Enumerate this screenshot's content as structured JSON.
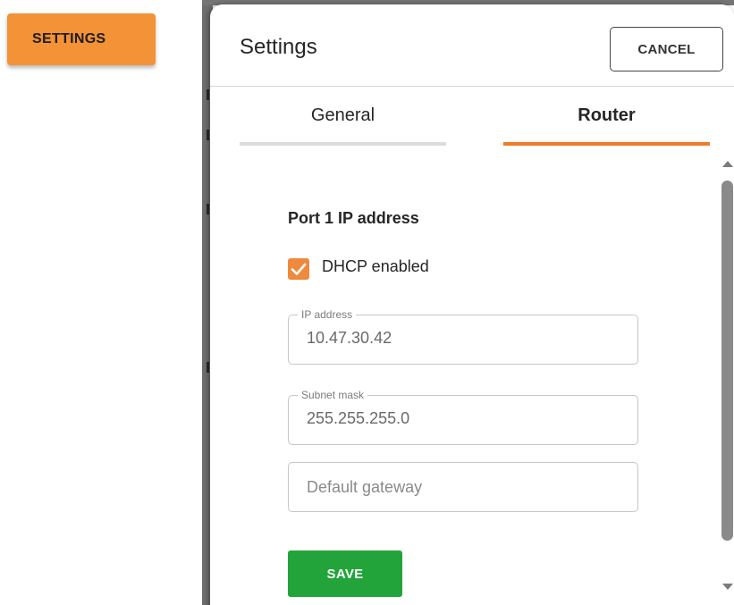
{
  "app": {
    "settings_button_label": "SETTINGS"
  },
  "dialog": {
    "title": "Settings",
    "cancel_label": "CANCEL",
    "tabs": [
      {
        "label": "General",
        "active": false
      },
      {
        "label": "Router",
        "active": true
      }
    ],
    "section_title": "Port 1 IP address",
    "dhcp": {
      "label": "DHCP enabled",
      "checked": true
    },
    "fields": {
      "ip_address": {
        "label": "IP address",
        "value": "10.47.30.42"
      },
      "subnet_mask": {
        "label": "Subnet mask",
        "value": "255.255.255.0"
      },
      "default_gateway": {
        "placeholder": "Default gateway",
        "value": ""
      }
    },
    "save_label": "SAVE"
  },
  "colors": {
    "accent": "#ee7d29",
    "settings_button": "#f39236",
    "save": "#22a43b"
  },
  "icons": {
    "checkbox": "check-icon",
    "scroll_up": "scroll-up-arrow-icon",
    "scroll_down": "scroll-down-arrow-icon"
  }
}
